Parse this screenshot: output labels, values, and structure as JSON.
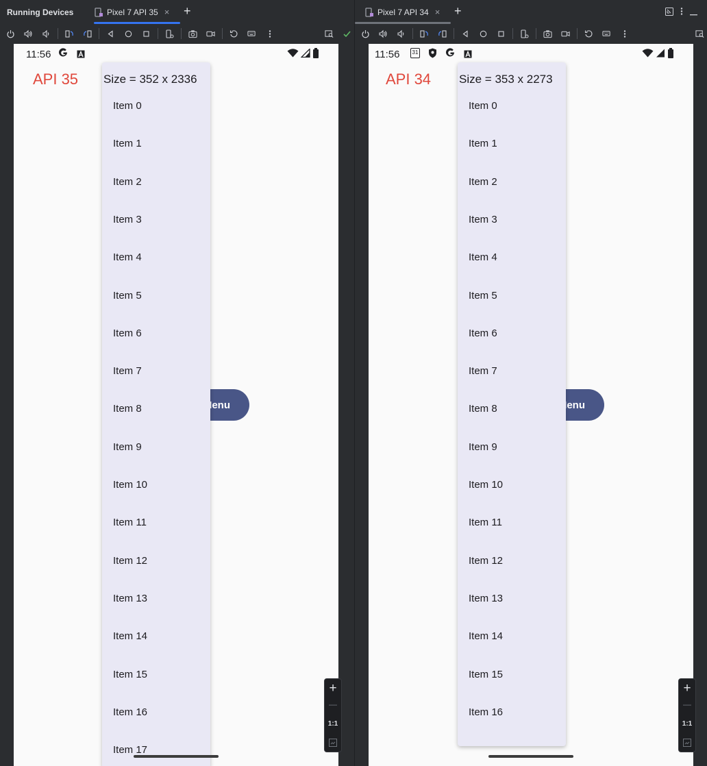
{
  "tool_window_title": "Running Devices",
  "new_tab_glyph": "+",
  "tab_close_glyph": "×",
  "left": {
    "tab_label": "Pixel 7 API 35",
    "tab_active": true,
    "status_time": "11:56",
    "api_label": "API 35",
    "menu_button_label": "Menu",
    "size_text": "Size = 352 x 2336",
    "items": [
      "Item 0",
      "Item 1",
      "Item 2",
      "Item 3",
      "Item 4",
      "Item 5",
      "Item 6",
      "Item 7",
      "Item 8",
      "Item 9",
      "Item 10",
      "Item 11",
      "Item 12",
      "Item 13",
      "Item 14",
      "Item 15",
      "Item 16",
      "Item 17"
    ]
  },
  "right": {
    "tab_label": "Pixel 7 API 34",
    "tab_active": false,
    "status_time": "11:56",
    "calendar_day": "31",
    "api_label": "API 34",
    "menu_button_label": "Menu",
    "size_text": "Size = 353 x 2273",
    "items": [
      "Item 0",
      "Item 1",
      "Item 2",
      "Item 3",
      "Item 4",
      "Item 5",
      "Item 6",
      "Item 7",
      "Item 8",
      "Item 9",
      "Item 10",
      "Item 11",
      "Item 12",
      "Item 13",
      "Item 14",
      "Item 15",
      "Item 16"
    ]
  },
  "zoom": {
    "plus": "+",
    "minus": "—",
    "one_to_one": "1:1"
  },
  "colors": {
    "ide_background": "#2b2d30",
    "active_tab_underline": "#3574f0",
    "inactive_tab_underline": "#6f737a",
    "api_label": "#e0483c",
    "menu_button": "#495687",
    "popup_background": "#e9e8f5",
    "device_background": "#fafafa",
    "check_green": "#5fb865"
  }
}
